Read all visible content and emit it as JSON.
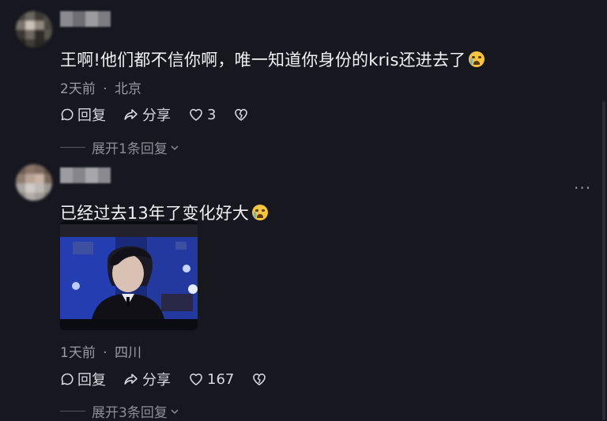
{
  "comments": [
    {
      "text": "王啊!他们都不信你啊，唯一知道你身份的kris还进去了",
      "emoji": "crying-face-emoji",
      "time": "2天前",
      "separator": "·",
      "location": "北京",
      "reply_label": "回复",
      "share_label": "分享",
      "like_count": "3",
      "expand_replies": "展开1条回复"
    },
    {
      "text": "已经过去13年了变化好大",
      "emoji": "crying-face-emoji",
      "time": "1天前",
      "separator": "·",
      "location": "四川",
      "reply_label": "回复",
      "share_label": "分享",
      "like_count": "167",
      "expand_replies": "展开3条回复"
    }
  ],
  "more_icon": "ellipsis-icon",
  "colors": {
    "background": "#16171f",
    "text": "#f2f2f5",
    "meta": "#9a9ba6"
  }
}
